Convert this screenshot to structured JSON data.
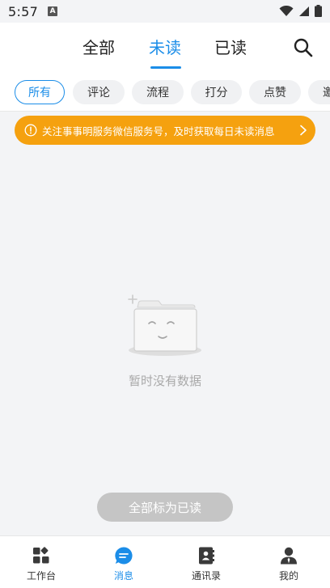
{
  "status_bar": {
    "time": "5:57",
    "badge": "A"
  },
  "header": {
    "tabs": [
      {
        "label": "全部",
        "active": false
      },
      {
        "label": "未读",
        "active": true
      },
      {
        "label": "已读",
        "active": false
      }
    ]
  },
  "filters": [
    {
      "label": "所有",
      "active": true
    },
    {
      "label": "评论",
      "active": false
    },
    {
      "label": "流程",
      "active": false
    },
    {
      "label": "打分",
      "active": false
    },
    {
      "label": "点赞",
      "active": false
    },
    {
      "label": "邀",
      "active": false
    }
  ],
  "notice": {
    "text": "关注事事明服务微信服务号，及时获取每日未读消息"
  },
  "empty": {
    "text": "暂时没有数据"
  },
  "mark_all_read_label": "全部标为已读",
  "bottom_nav": [
    {
      "label": "工作台",
      "icon": "grid-icon",
      "active": false
    },
    {
      "label": "消息",
      "icon": "message-icon",
      "active": true
    },
    {
      "label": "通讯录",
      "icon": "contacts-icon",
      "active": false
    },
    {
      "label": "我的",
      "icon": "person-icon",
      "active": false
    }
  ],
  "colors": {
    "accent": "#1b8de8",
    "notice": "#f5a10f",
    "disabled_button": "#c5c5c5",
    "background": "#f3f4f6"
  }
}
